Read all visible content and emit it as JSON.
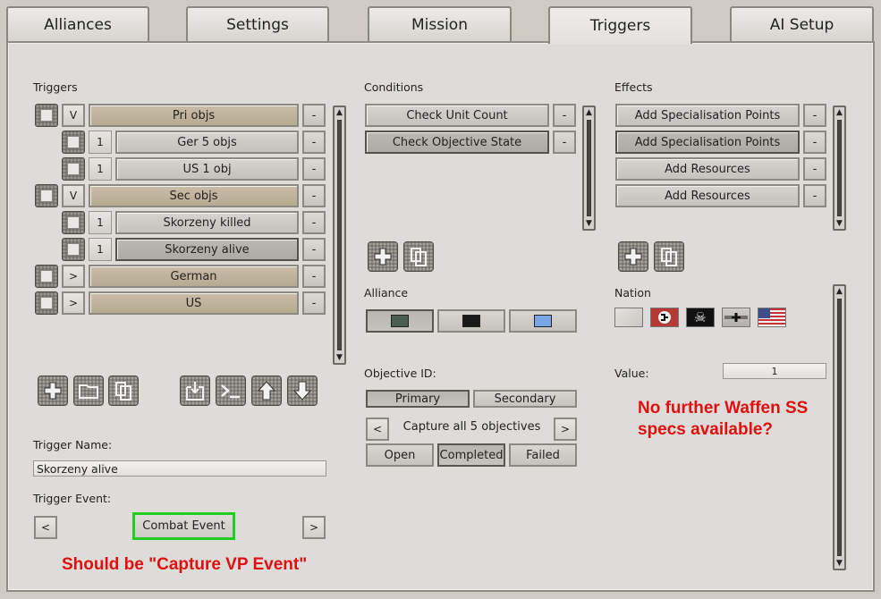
{
  "tabs": [
    "Alliances",
    "Settings",
    "Mission",
    "Triggers",
    "AI Setup"
  ],
  "active_tab": "Triggers",
  "triggers": {
    "heading": "Triggers",
    "items": [
      {
        "toggle": "V",
        "label": "Pri objs",
        "level": 0
      },
      {
        "toggle": "1",
        "label": "Ger 5 objs",
        "level": 1
      },
      {
        "toggle": "1",
        "label": "US 1 obj",
        "level": 1
      },
      {
        "toggle": "V",
        "label": "Sec objs",
        "level": 0
      },
      {
        "toggle": "1",
        "label": "Skorzeny killed",
        "level": 1
      },
      {
        "toggle": "1",
        "label": "Skorzeny alive",
        "level": 1
      },
      {
        "toggle": ">",
        "label": "German",
        "level": 0
      },
      {
        "toggle": ">",
        "label": "US",
        "level": 0
      }
    ],
    "remove_label": "-",
    "name_label": "Trigger Name:",
    "name_value": "Skorzeny alive",
    "event_label": "Trigger Event:",
    "event_value": "Combat Event",
    "prev": "<",
    "next": ">"
  },
  "conditions": {
    "heading": "Conditions",
    "items": [
      "Check Unit Count",
      "Check Objective State"
    ],
    "remove_label": "-"
  },
  "effects": {
    "heading": "Effects",
    "items": [
      "Add Specialisation Points",
      "Add Specialisation Points",
      "Add Resources",
      "Add Resources"
    ],
    "remove_label": "-"
  },
  "alliance": {
    "heading": "Alliance",
    "colors": [
      "#4a5e50",
      "#1a1a1a",
      "#7aa6e8"
    ]
  },
  "objective": {
    "heading": "Objective ID:",
    "type_options": [
      "Primary",
      "Secondary"
    ],
    "selected_type": "Primary",
    "prev": "<",
    "next": ">",
    "value": "Capture all 5 objectives",
    "states": [
      "Open",
      "Completed",
      "Failed"
    ],
    "selected_state": "Completed"
  },
  "nation": {
    "heading": "Nation",
    "flags": [
      "blank-flag-icon",
      "german-ww2-flag-icon",
      "skull-flag-icon",
      "german-cross-flag-icon",
      "us-flag-icon"
    ]
  },
  "value_field": {
    "label": "Value:",
    "value": "1"
  },
  "annotations": {
    "left": "Should be \"Capture VP Event\"",
    "right_line1": "No further Waffen SS",
    "right_line2": "specs available?"
  },
  "colors": {
    "annotation_red": "#e01010",
    "highlight_green": "#22cc22",
    "tan_row": "#c2b59e"
  }
}
